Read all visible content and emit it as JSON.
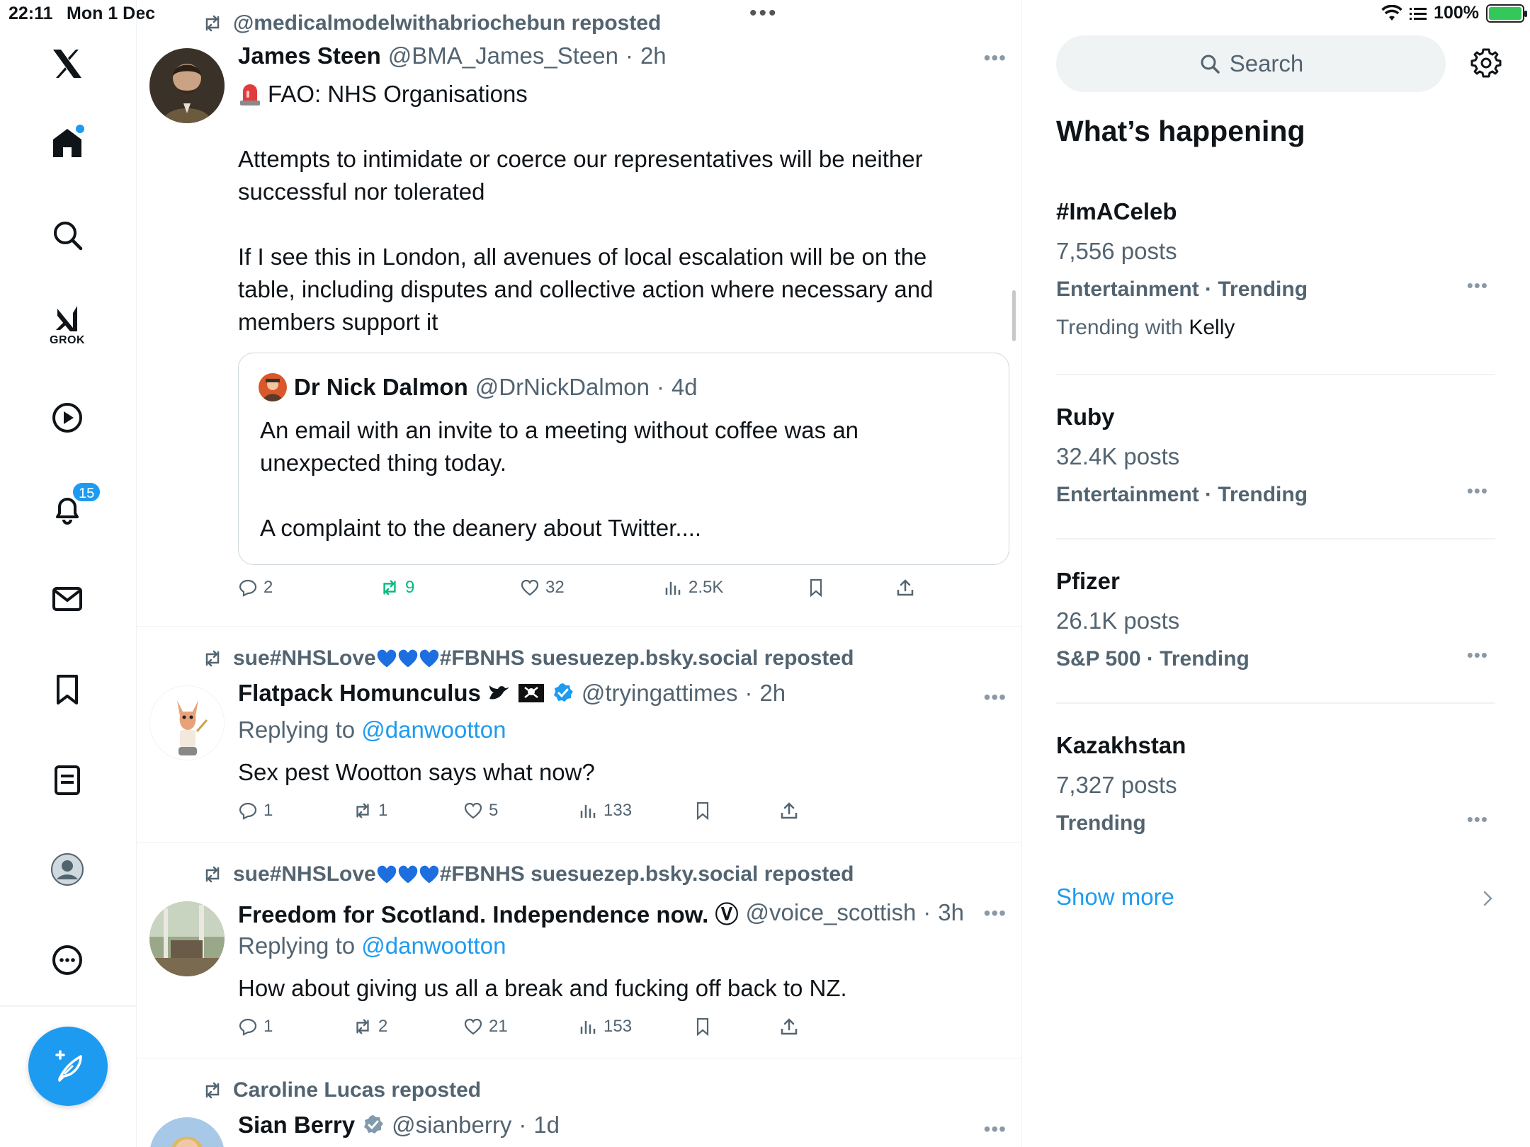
{
  "status_bar": {
    "time": "22:11",
    "date": "Mon 1 Dec",
    "battery": "100%",
    "icons": [
      "wifi-icon",
      "signal-list-icon",
      "battery-charging-icon"
    ]
  },
  "nav": {
    "grok_label": "GROK",
    "notifications_badge": "15",
    "items": [
      "x-logo",
      "home",
      "search",
      "grok",
      "video",
      "notifications",
      "messages",
      "bookmarks",
      "lists",
      "profile",
      "more"
    ],
    "accent": "#1d9bf0"
  },
  "feed": {
    "tweets": [
      {
        "repost_by": "@medicalmodelwithabriochebun reposted",
        "name": "James Steen",
        "handle": "@BMA_James_Steen",
        "sep": "·",
        "time": "2h",
        "line1": "FAO: NHS Organisations",
        "para2": "Attempts to intimidate or coerce our representatives will be neither successful nor tolerated",
        "para3": "If I see this in London, all avenues of local escalation will be on the table, including disputes and collective action where necessary and members support it",
        "quote": {
          "name": "Dr Nick Dalmon",
          "handle": "@DrNickDalmon",
          "sep": "·",
          "time": "4d",
          "para1": "An email with an invite to a meeting without coffee was an unexpected thing today.",
          "para2": "A complaint to the deanery about Twitter...."
        },
        "stats": {
          "replies": "2",
          "reposts": "9",
          "likes": "32",
          "views": "2.5K"
        }
      },
      {
        "repost_by_pre": "sue#NHSLove",
        "repost_by_post": "#FBNHS suesuezep.bsky.social reposted",
        "name": "Flatpack Homunculus",
        "handle": "@tryingattimes",
        "sep": "·",
        "time": "2h",
        "replying_to_label": "Replying to",
        "replying_to": "@danwootton",
        "text": "Sex pest Wootton says what now?",
        "stats": {
          "replies": "1",
          "reposts": "1",
          "likes": "5",
          "views": "133"
        }
      },
      {
        "repost_by_pre": "sue#NHSLove",
        "repost_by_post": "#FBNHS suesuezep.bsky.social reposted",
        "name": "Freedom for Scotland. Independence now. Ⓥ",
        "handle": "@voice_scottish",
        "sep": "·",
        "time": "3h",
        "replying_to_label": "Replying to",
        "replying_to": "@danwootton",
        "text": "How about giving us all a break and fucking off back to NZ.",
        "stats": {
          "replies": "1",
          "reposts": "2",
          "likes": "21",
          "views": "153"
        }
      },
      {
        "repost_by": "Caroline Lucas reposted",
        "name": "Sian Berry",
        "handle": "@sianberry",
        "sep": "·",
        "time": "1d"
      }
    ]
  },
  "sidebar": {
    "search_placeholder": "Search",
    "title": "What’s happening",
    "trends": [
      {
        "name": "#ImACeleb",
        "count": "7,556 posts",
        "category": "Entertainment · Trending",
        "with_label": "Trending with",
        "with": "Kelly"
      },
      {
        "name": "Ruby",
        "count": "32.4K posts",
        "category": "Entertainment · Trending"
      },
      {
        "name": "Pfizer",
        "count": "26.1K posts",
        "category": "S&P 500 · Trending"
      },
      {
        "name": "Kazakhstan",
        "count": "7,327 posts",
        "category": "Trending"
      }
    ],
    "show_more": "Show more"
  },
  "colors": {
    "text_primary": "#0f1419",
    "text_secondary": "#536471",
    "link": "#1d9bf0",
    "repost_active": "#00ba7c",
    "divider": "#eff3f4"
  }
}
